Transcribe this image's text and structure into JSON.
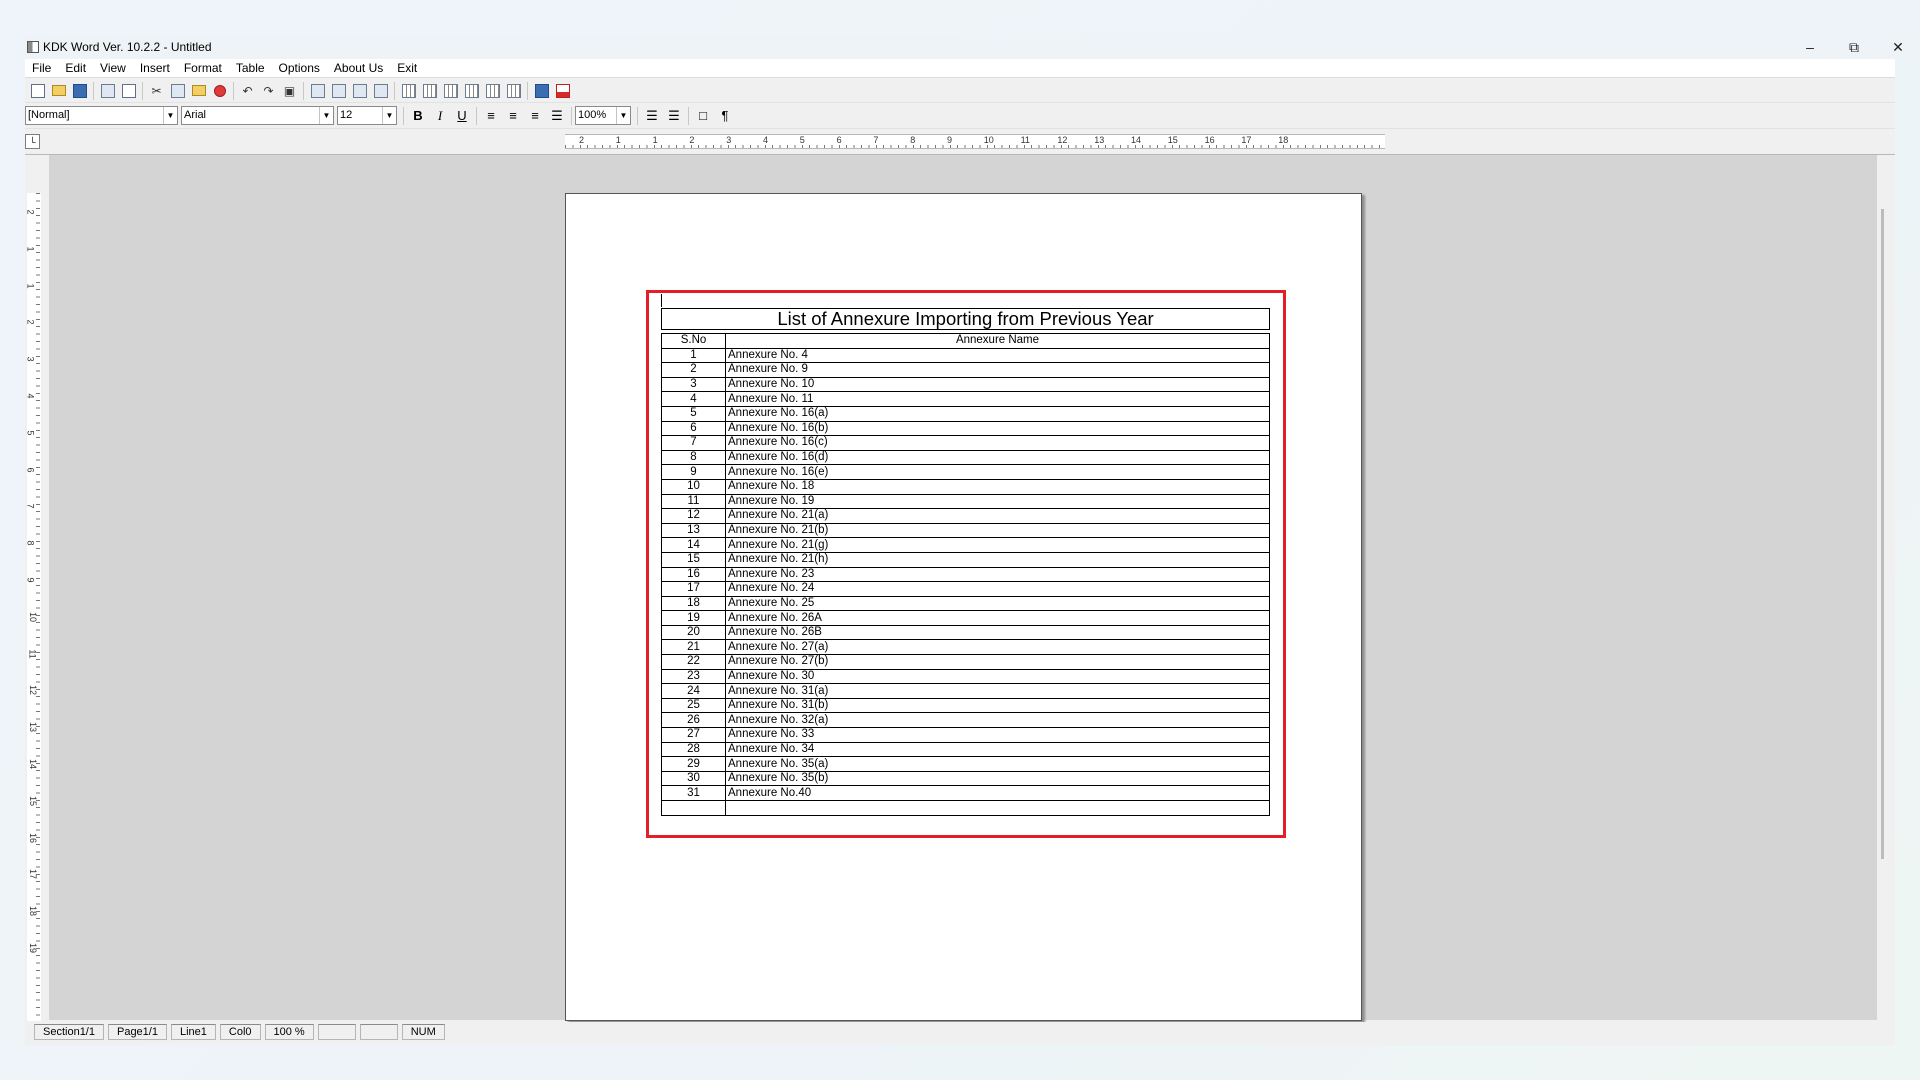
{
  "window": {
    "title": "KDK Word Ver. 10.2.2 - Untitled"
  },
  "menu": [
    "File",
    "Edit",
    "View",
    "Insert",
    "Format",
    "Table",
    "Options",
    "About Us",
    "Exit"
  ],
  "formatbar": {
    "style": "[Normal]",
    "font": "Arial",
    "size": "12",
    "zoom": "100%",
    "bold": "B",
    "italic": "I",
    "underline": "U",
    "pilcrow": "¶"
  },
  "ruler": {
    "h_labels": [
      "2",
      "1",
      "1",
      "2",
      "3",
      "4",
      "5",
      "6",
      "7",
      "8",
      "9",
      "10",
      "11",
      "12",
      "13",
      "14",
      "15",
      "16",
      "17",
      "18"
    ],
    "v_labels": [
      "2",
      "1",
      "1",
      "2",
      "3",
      "4",
      "5",
      "6",
      "7",
      "8",
      "9",
      "10",
      "11",
      "12",
      "13",
      "14",
      "15",
      "16",
      "17",
      "18",
      "19"
    ]
  },
  "document": {
    "table_title": "List of Annexure Importing from Previous Year",
    "headers": [
      "S.No",
      "Annexure Name"
    ],
    "rows": [
      [
        "1",
        "Annexure No. 4"
      ],
      [
        "2",
        "Annexure No. 9"
      ],
      [
        "3",
        "Annexure No. 10"
      ],
      [
        "4",
        "Annexure No. 11"
      ],
      [
        "5",
        "Annexure No. 16(a)"
      ],
      [
        "6",
        "Annexure No. 16(b)"
      ],
      [
        "7",
        "Annexure No. 16(c)"
      ],
      [
        "8",
        "Annexure No. 16(d)"
      ],
      [
        "9",
        "Annexure No. 16(e)"
      ],
      [
        "10",
        "Annexure No. 18"
      ],
      [
        "11",
        "Annexure No. 19"
      ],
      [
        "12",
        "Annexure No. 21(a)"
      ],
      [
        "13",
        "Annexure No. 21(b)"
      ],
      [
        "14",
        "Annexure No. 21(g)"
      ],
      [
        "15",
        "Annexure No. 21(h)"
      ],
      [
        "16",
        "Annexure No. 23"
      ],
      [
        "17",
        "Annexure No. 24"
      ],
      [
        "18",
        "Annexure No. 25"
      ],
      [
        "19",
        "Annexure No. 26A"
      ],
      [
        "20",
        "Annexure No. 26B"
      ],
      [
        "21",
        "Annexure No. 27(a)"
      ],
      [
        "22",
        "Annexure No. 27(b)"
      ],
      [
        "23",
        "Annexure No. 30"
      ],
      [
        "24",
        "Annexure No. 31(a)"
      ],
      [
        "25",
        "Annexure No. 31(b)"
      ],
      [
        "26",
        "Annexure No. 32(a)"
      ],
      [
        "27",
        "Annexure No. 33"
      ],
      [
        "28",
        "Annexure No. 34"
      ],
      [
        "29",
        "Annexure No. 35(a)"
      ],
      [
        "30",
        "Annexure No. 35(b)"
      ],
      [
        "31",
        "Annexure No.40"
      ]
    ],
    "highlight_color": "#e41e26"
  },
  "statusbar": [
    "Section1/1",
    "Page1/1",
    "Line1",
    "Col0",
    "100 %",
    "",
    "",
    "NUM"
  ]
}
